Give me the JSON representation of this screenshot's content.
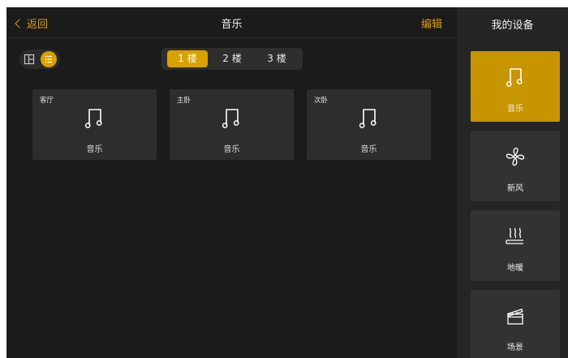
{
  "header": {
    "back_label": "返回",
    "title": "音乐",
    "edit_label": "编辑"
  },
  "floors": {
    "tabs": [
      "1 楼",
      "2 楼",
      "3 楼"
    ],
    "selected": "1 楼"
  },
  "rooms": [
    {
      "room": "客厅",
      "device": "音乐"
    },
    {
      "room": "主卧",
      "device": "音乐"
    },
    {
      "room": "次卧",
      "device": "音乐"
    }
  ],
  "sidebar": {
    "title": "我的设备",
    "items": [
      {
        "label": "音乐",
        "icon": "music-note-icon",
        "active": true
      },
      {
        "label": "新风",
        "icon": "fan-icon",
        "active": false
      },
      {
        "label": "地暖",
        "icon": "floor-heating-icon",
        "active": false
      },
      {
        "label": "场景",
        "icon": "clapperboard-icon",
        "active": false
      }
    ]
  },
  "colors": {
    "accent": "#d9a100",
    "background": "#1b1b1b",
    "card": "#2d2d2d",
    "sidebar": "#252525"
  }
}
